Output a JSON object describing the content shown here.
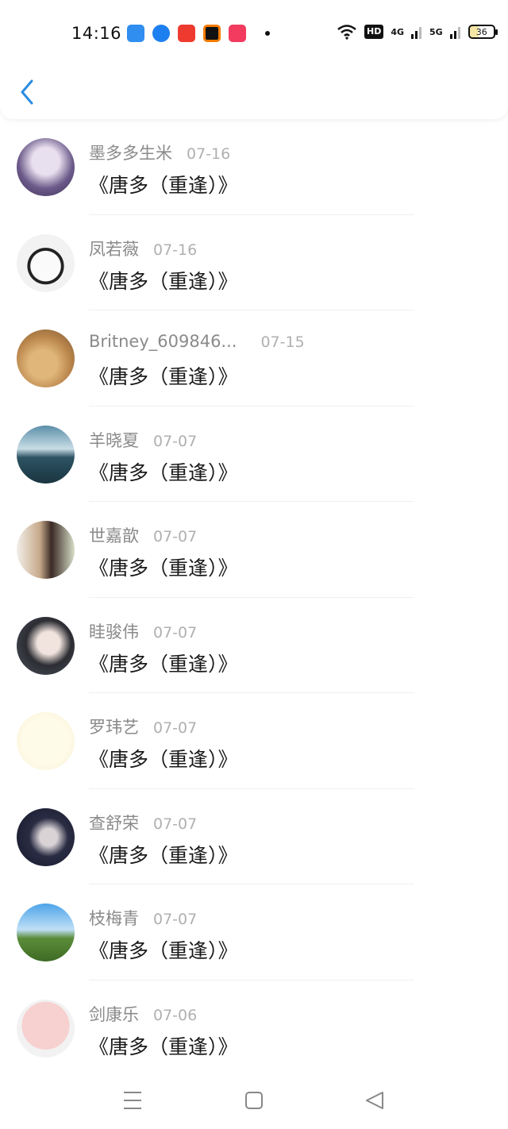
{
  "status_bar": {
    "time": "14:16",
    "hd": "HD",
    "net1": "4G",
    "net2": "5G",
    "battery": "36"
  },
  "header": {
    "back_icon": "chevron-left-icon",
    "accent": "#2a8de0"
  },
  "comments": [
    {
      "name": "墨多多生米",
      "date": "07-16",
      "text": "《唐多（重逢）》",
      "avatar": "anime-girl"
    },
    {
      "name": "凤若薇",
      "date": "07-16",
      "text": "《唐多（重逢）》",
      "avatar": "cow-sunglasses"
    },
    {
      "name": "Britney_609846...",
      "date": "07-15",
      "text": "《唐多（重逢）》",
      "avatar": "dog-costume"
    },
    {
      "name": "羊晓夏",
      "date": "07-07",
      "text": "《唐多（重逢）》",
      "avatar": "ocean-sky"
    },
    {
      "name": "世嘉歆",
      "date": "07-07",
      "text": "《唐多（重逢）》",
      "avatar": "girl-portrait"
    },
    {
      "name": "眭骏伟",
      "date": "07-07",
      "text": "《唐多（重逢）》",
      "avatar": "woman-portrait"
    },
    {
      "name": "罗玮艺",
      "date": "07-07",
      "text": "《唐多（重逢）》",
      "avatar": "penguins"
    },
    {
      "name": "查舒荣",
      "date": "07-07",
      "text": "《唐多（重逢）》",
      "avatar": "anime-dark"
    },
    {
      "name": "枝梅青",
      "date": "07-07",
      "text": "《唐多（重逢）》",
      "avatar": "field-sky"
    },
    {
      "name": "剑康乐",
      "date": "07-06",
      "text": "《唐多（重逢）》",
      "avatar": "pink-cartoon"
    }
  ],
  "nav": {
    "menu": "menu-icon",
    "home": "home-square-icon",
    "back": "back-triangle-icon"
  }
}
